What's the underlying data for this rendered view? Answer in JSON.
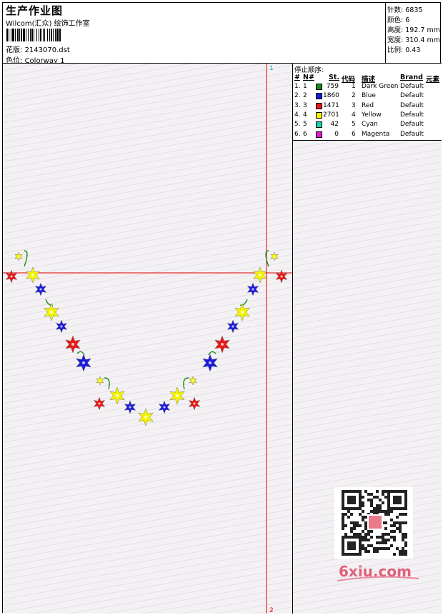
{
  "header": {
    "title": "生产作业图",
    "company": "Wilcom(汇众) 绘饰工作室",
    "design_file_label": "花版:",
    "design_file": "2143070.dst",
    "colorway_label": "色位:",
    "colorway": "Colorway 1"
  },
  "stats": [
    {
      "label": "针数:",
      "value": "6835"
    },
    {
      "label": "颜色:",
      "value": "6"
    },
    {
      "label": "高度:",
      "value": "192.7 mm"
    },
    {
      "label": "宽度:",
      "value": "310.4 mm"
    },
    {
      "label": "比例:",
      "value": "0.43"
    }
  ],
  "stop_sequence": {
    "title": "停止顺序:",
    "columns": [
      "#",
      "N#",
      "St.",
      "代码",
      "描述",
      "Brand",
      "元素"
    ],
    "rows": [
      {
        "index": "1.",
        "n": "1",
        "color": "#1a8a1a",
        "stitches": "759",
        "code": "1",
        "desc": "Dark Green",
        "brand": "Default"
      },
      {
        "index": "2.",
        "n": "2",
        "color": "#1a1adc",
        "stitches": "1860",
        "code": "2",
        "desc": "Blue",
        "brand": "Default"
      },
      {
        "index": "3.",
        "n": "3",
        "color": "#e81818",
        "stitches": "1471",
        "code": "3",
        "desc": "Red",
        "brand": "Default"
      },
      {
        "index": "4.",
        "n": "4",
        "color": "#f4f400",
        "stitches": "2701",
        "code": "4",
        "desc": "Yellow",
        "brand": "Default"
      },
      {
        "index": "5.",
        "n": "5",
        "color": "#18d0b0",
        "stitches": "42",
        "code": "5",
        "desc": "Cyan",
        "brand": "Default"
      },
      {
        "index": "6.",
        "n": "6",
        "color": "#e018d8",
        "stitches": "0",
        "code": "6",
        "desc": "Magenta",
        "brand": "Default"
      }
    ]
  },
  "markers": {
    "top": "1",
    "bottom": "2"
  },
  "watermark": {
    "text": "6xiu.com"
  },
  "colors": {
    "guide": "#e00000",
    "marker_top": "#18a8a8",
    "marker_bottom": "#e00000"
  }
}
